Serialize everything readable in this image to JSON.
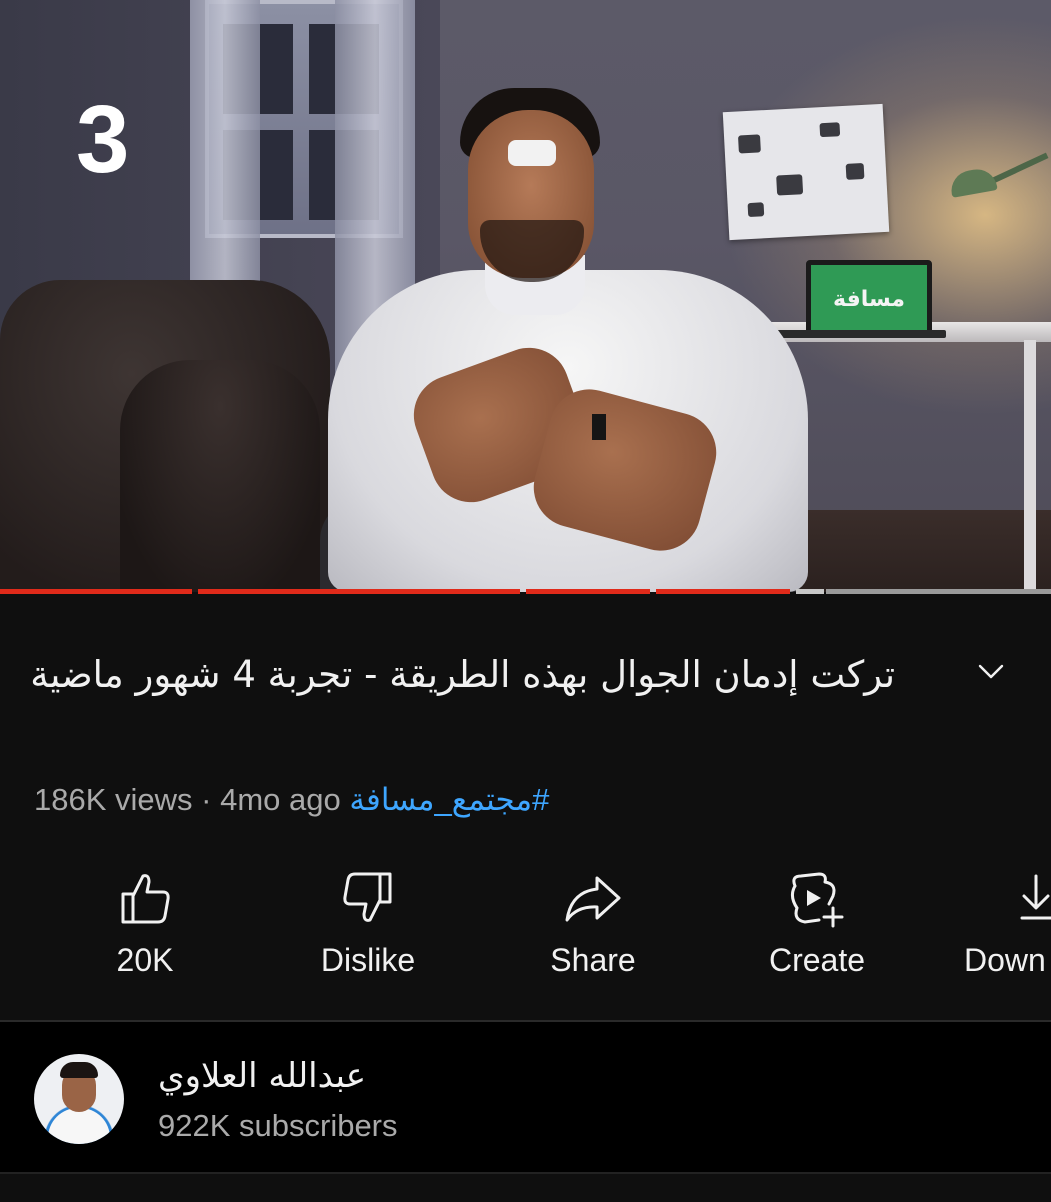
{
  "video": {
    "overlay_number": "3",
    "laptop_logo_text": "مسافة",
    "progress_segments_color": "#e02a1a",
    "remaining_color": "#9a9a9a"
  },
  "title": {
    "text": "تركت إدمان الجوال بهذه الطريقة  - تجربة 4 شهور ماضية"
  },
  "meta": {
    "views": "186K views",
    "separator": "·",
    "age": "4mo ago",
    "hashtag": "#مجتمع_مسافة"
  },
  "actions": [
    {
      "label": "20K",
      "icon": "thumbs-up-icon"
    },
    {
      "label": "Dislike",
      "icon": "thumbs-down-icon"
    },
    {
      "label": "Share",
      "icon": "share-icon"
    },
    {
      "label": "Create",
      "icon": "create-icon"
    },
    {
      "label": "Down",
      "icon": "download-icon"
    }
  ],
  "channel": {
    "name": "عبدالله العلاوي",
    "subscribers": "922K subscribers"
  },
  "colors": {
    "background": "#0f0f0f",
    "hashtag": "#3ea6ff",
    "secondary_text": "#aaaaaa"
  }
}
